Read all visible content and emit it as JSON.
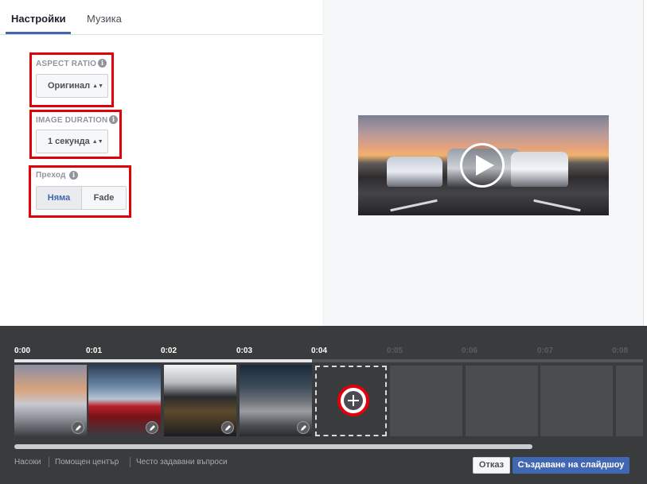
{
  "tabs": [
    {
      "label": "Настройки",
      "active": true
    },
    {
      "label": "Музика",
      "active": false
    }
  ],
  "settings": {
    "aspect_ratio": {
      "label": "ASPECT RATIO",
      "value": "Оригинал"
    },
    "image_duration": {
      "label": "IMAGE DURATION",
      "value": "1 секунда"
    },
    "transition": {
      "label": "Преход",
      "options": [
        "Няма",
        "Fade"
      ],
      "selected": "Няма"
    }
  },
  "preview": {
    "play_icon": "play-icon"
  },
  "timeline": {
    "times": [
      "0:00",
      "0:01",
      "0:02",
      "0:03",
      "0:04",
      "0:05",
      "0:06",
      "0:07",
      "0:08"
    ],
    "active_count": 5,
    "progress": 0.47
  },
  "footer": {
    "links": [
      "Насоки",
      "Помощен център",
      "Често задавани въпроси"
    ],
    "cancel_label": "Отказ",
    "create_label": "Създаване на слайдшоу"
  },
  "colors": {
    "accent": "#4267b2",
    "highlight": "#e0000a"
  }
}
